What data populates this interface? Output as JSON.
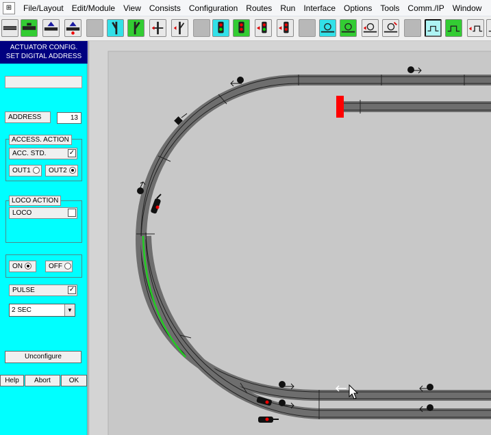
{
  "menu": {
    "system_icon": "⊞",
    "items": [
      "File/Layout",
      "Edit/Module",
      "View",
      "Consists",
      "Configuration",
      "Routes",
      "Run",
      "Interface",
      "Options",
      "Tools",
      "Comm./IP",
      "Window"
    ]
  },
  "panel": {
    "header_line1": "ACTUATOR CONFIG.",
    "header_line2": "SET DIGITAL ADDRESS",
    "name_value": "",
    "address_label": "ADDRESS",
    "address_value": "13",
    "access_action": {
      "title": "ACCESS. ACTION",
      "acc_std_label": "ACC. STD.",
      "acc_std_checked": "✓",
      "out1_label": "OUT1",
      "out2_label": "OUT2",
      "selected": "OUT2"
    },
    "loco_action": {
      "title": "LOCO ACTION",
      "loco_label": "LOCO",
      "loco_checked": ""
    },
    "on_label": "ON",
    "off_label": "OFF",
    "power_selected": "ON",
    "pulse_label": "PULSE",
    "pulse_checked": "✓",
    "duration_value": "2 SEC",
    "dropdown_arrow": "▼",
    "unconfigure_label": "Unconfigure",
    "help_label": "Help",
    "abort_label": "Abort",
    "ok_label": "OK"
  },
  "colors": {
    "panel_bg": "#00ffff",
    "header_bg": "#000080",
    "canvas_bg": "#d4d4d4",
    "track_rail": "#6e6e6e",
    "active_segment": "#22cc22",
    "buffer_stop": "#ff0000"
  },
  "toolbar": {
    "groups": [
      {
        "icons": [
          "track-segment-icon",
          "track-segment-green-icon",
          "block-arrow-icon",
          "block-arrow-red-icon"
        ]
      },
      {
        "icons": [
          "turnout-left-icon",
          "turnout-right-icon",
          "turnout-double-icon",
          "turnout-double-red-icon"
        ]
      },
      {
        "icons": [
          "signal-green-icon",
          "signal-red-icon",
          "signal-arrow-icon",
          "signal-arrow-red-icon"
        ]
      },
      {
        "icons": [
          "actuator-icon",
          "actuator-green-icon",
          "actuator-red-icon",
          "actuator-swap-icon"
        ]
      },
      {
        "icons": [
          "pulse-icon",
          "pulse-green-icon",
          "pulse-arrow-icon",
          "pulse-next-icon"
        ]
      }
    ]
  }
}
